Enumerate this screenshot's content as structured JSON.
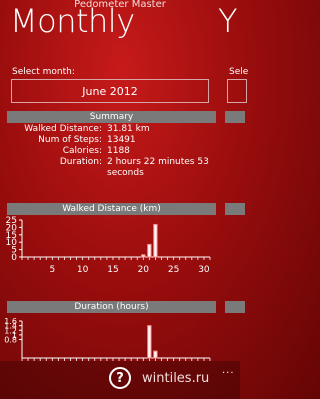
{
  "app": {
    "title": "Pedometer Master"
  },
  "pivot": {
    "current": "Monthly",
    "next": "Y",
    "next_select_label": "Sele"
  },
  "month": {
    "label": "Select month:",
    "selected": "June 2012"
  },
  "summary": {
    "header": "Summary",
    "rows": [
      {
        "label": "Walked Distance:",
        "value": "31.81 km"
      },
      {
        "label": "Num of Steps:",
        "value": "13491"
      },
      {
        "label": "Calories:",
        "value": "1188"
      },
      {
        "label": "Duration:",
        "value": "2 hours 22 minutes 53 seconds"
      }
    ]
  },
  "chart_data": [
    {
      "type": "bar",
      "title": "Walked Distance (km)",
      "x": [
        20,
        21,
        22
      ],
      "values": [
        1.5,
        8.5,
        22
      ],
      "xlim": [
        0,
        31
      ],
      "xticks": [
        5,
        10,
        15,
        20,
        25,
        30
      ],
      "ylim": [
        0,
        25
      ],
      "yticks": [
        0,
        5,
        10,
        15,
        20,
        25
      ]
    },
    {
      "type": "bar",
      "title": "Duration (hours)",
      "x": [
        21,
        22
      ],
      "values": [
        1.4,
        0.3
      ],
      "xlim": [
        0,
        31
      ],
      "ylim": [
        0,
        1.6
      ],
      "yticks": [
        0.8,
        1,
        1.2,
        1.4,
        1.6
      ]
    }
  ],
  "appbar": {
    "help": "?",
    "more": "..."
  },
  "watermark": "wintiles.ru",
  "colors": {
    "bar_stroke": "#ff8a8a",
    "bar_fill": "#ffffff",
    "header_bg": "#7a7a7a"
  }
}
